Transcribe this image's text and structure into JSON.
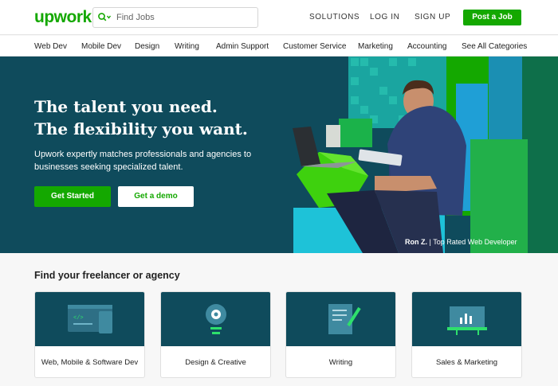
{
  "header": {
    "logo": "upwork",
    "search_placeholder": "Find Jobs",
    "links": [
      "SOLUTIONS",
      "LOG IN",
      "SIGN UP"
    ],
    "post_job": "Post a Job"
  },
  "categories": [
    "Web Dev",
    "Mobile Dev",
    "Design",
    "Writing",
    "Admin Support",
    "Customer Service",
    "Marketing",
    "Accounting",
    "See All Categories"
  ],
  "hero": {
    "title_line1": "The talent you need.",
    "title_line2": "The flexibility you want.",
    "subtitle": "Upwork expertly matches professionals and agencies to businesses seeking specialized talent.",
    "primary_cta": "Get Started",
    "secondary_cta": "Get a demo",
    "caption_name": "Ron Z.",
    "caption_role": "Top Rated Web Developer"
  },
  "section": {
    "title": "Find your freelancer or agency",
    "cards": [
      {
        "label": "Web, Mobile & Software Dev",
        "icon": "devices-icon"
      },
      {
        "label": "Design & Creative",
        "icon": "lightbulb-gear-icon"
      },
      {
        "label": "Writing",
        "icon": "document-pen-icon"
      },
      {
        "label": "Sales & Marketing",
        "icon": "presentation-chart-icon"
      }
    ]
  },
  "colors": {
    "brand_green": "#14a800",
    "hero_bg": "#0f4b5c"
  }
}
